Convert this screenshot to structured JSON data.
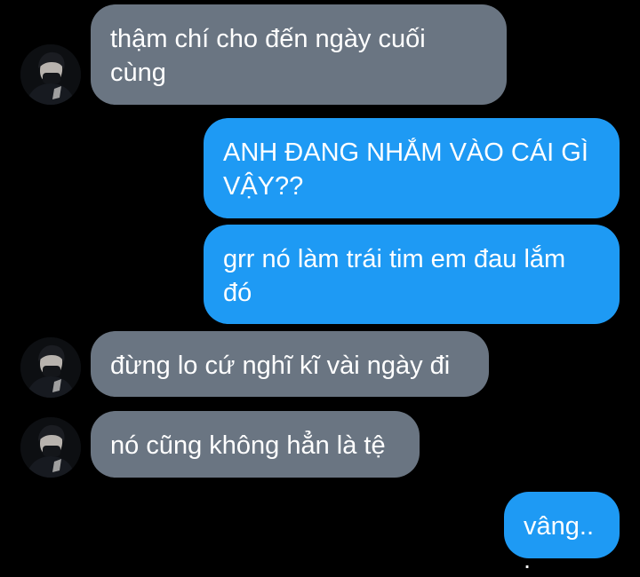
{
  "conversation": {
    "messages": [
      {
        "sender": "contact",
        "text": "thậm chí cho đến ngày cuối cùng"
      },
      {
        "sender": "me",
        "text": "ANH ĐANG NHẮM VÀO CÁI GÌ VẬY??"
      },
      {
        "sender": "me",
        "text": "grr nó làm trái tim em đau lắm đó"
      },
      {
        "sender": "contact",
        "text": "đừng lo cứ nghĩ kĩ vài ngày đi"
      },
      {
        "sender": "contact",
        "text": "nó cũng không hẳn là tệ"
      },
      {
        "sender": "me",
        "text": "vâng..."
      }
    ]
  },
  "colors": {
    "background": "#000000",
    "incoming_bubble": "#6a7582",
    "outgoing_bubble": "#1e9af4",
    "text": "#ffffff"
  },
  "icons": {
    "contact_avatar": "contact-avatar-icon"
  }
}
